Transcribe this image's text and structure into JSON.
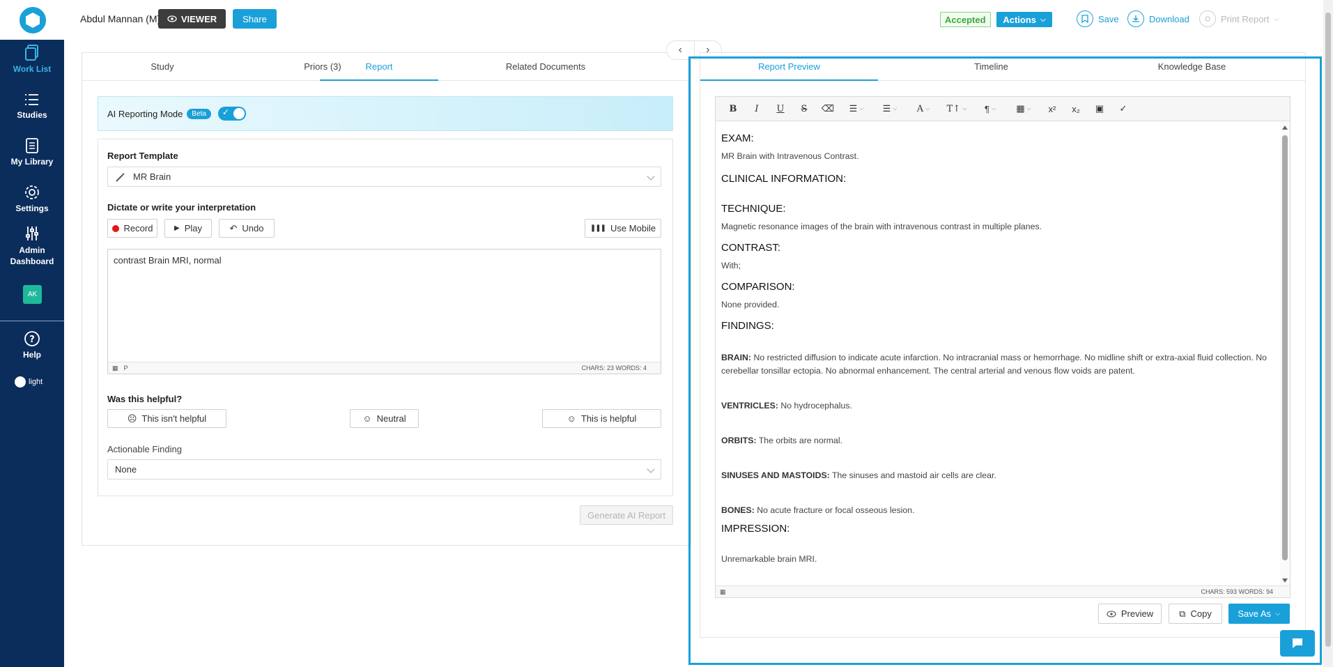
{
  "sidebar": {
    "items": [
      {
        "label": "Work List",
        "icon": "worklist-icon"
      },
      {
        "label": "Studies",
        "icon": "list-icon"
      },
      {
        "label": "My Library",
        "icon": "library-icon"
      },
      {
        "label": "Settings",
        "icon": "gear-icon"
      },
      {
        "label": "Admin Dashboard",
        "icon": "sliders-icon"
      }
    ],
    "avatar": "AK",
    "help": "Help",
    "theme": "light"
  },
  "header": {
    "user": "Abdul Mannan (M)",
    "viewer_label": "VIEWER",
    "share_label": "Share",
    "status": "Accepted",
    "actions_label": "Actions",
    "save_label": "Save",
    "download_label": "Download",
    "print_label": "Print Report"
  },
  "left": {
    "tabs": [
      "Study",
      "Priors (3)",
      "Report",
      "Related Documents"
    ],
    "active_tab": "Report",
    "ai_mode_label": "AI Reporting Mode",
    "beta_label": "Beta",
    "template_label": "Report Template",
    "template_value": "MR Brain",
    "dictate_label": "Dictate or write your interpretation",
    "record_label": "Record",
    "play_label": "Play",
    "undo_label": "Undo",
    "mobile_label": "Use Mobile",
    "dictation_text": "contrast Brain MRI, normal",
    "ta_para": "P",
    "ta_counts": "CHARS: 23   WORDS: 4",
    "helpful_label": "Was this helpful?",
    "not_helpful": "This isn't helpful",
    "neutral": "Neutral",
    "helpful": "This is helpful",
    "actionable_label": "Actionable Finding",
    "actionable_value": "None",
    "generate_label": "Generate AI Report"
  },
  "right": {
    "tabs": [
      "Report Preview",
      "Timeline",
      "Knowledge Base"
    ],
    "active_tab": "Report Preview",
    "report": {
      "exam_h": "EXAM:",
      "exam": "MR Brain with Intravenous Contrast.",
      "clinical_h": "CLINICAL INFORMATION:",
      "technique_h": "TECHNIQUE:",
      "technique": "Magnetic resonance images of the brain with intravenous contrast in multiple planes.",
      "contrast_h": "CONTRAST:",
      "contrast": "With;",
      "comparison_h": "COMPARISON:",
      "comparison": "None provided.",
      "findings_h": "FINDINGS:",
      "brain_k": "BRAIN:",
      "brain_v": " No restricted diffusion to indicate acute infarction. No intracranial mass or hemorrhage. No midline shift or extra-axial fluid collection. No cerebellar tonsillar ectopia. No abnormal enhancement. The central arterial and venous flow voids are patent.",
      "ventricles_k": "VENTRICLES:",
      "ventricles_v": " No hydrocephalus.",
      "orbits_k": "ORBITS:",
      "orbits_v": " The orbits are normal.",
      "sinuses_k": "SINUSES AND MASTOIDS:",
      "sinuses_v": " The sinuses and mastoid air cells are clear.",
      "bones_k": "BONES:",
      "bones_v": " No acute fracture or focal osseous lesion.",
      "impression_h": "IMPRESSION:",
      "impression": "Unremarkable brain MRI."
    },
    "counts": "CHARS: 593   WORDS: 94",
    "preview_label": "Preview",
    "copy_label": "Copy",
    "saveas_label": "Save As"
  },
  "colors": {
    "accent": "#1aa0d8",
    "sidebar": "#0b2d5b",
    "accepted": "#3da83d"
  }
}
